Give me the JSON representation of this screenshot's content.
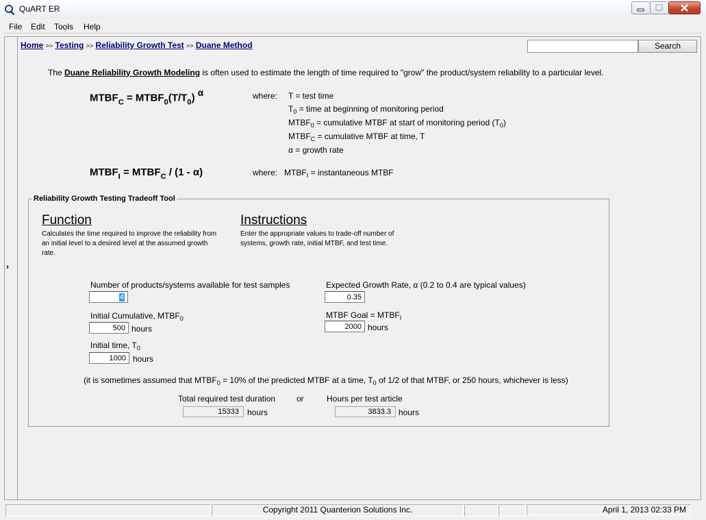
{
  "window": {
    "title": "QuART ER"
  },
  "menu": [
    "File",
    "Edit",
    "Tools",
    "Help"
  ],
  "breadcrumb": [
    {
      "label": "Home"
    },
    {
      "label": "Testing"
    },
    {
      "label": "Reliability Growth Test"
    },
    {
      "label": "Duane Method"
    }
  ],
  "breadcrumb_sep": ">>",
  "search": {
    "value": "",
    "button": "Search"
  },
  "intro": {
    "prefix": "The ",
    "link": "Duane Reliability Growth Modeling",
    "suffix": " is often used to estimate the length of time required to \"grow\" the product/system reliability to a particular level."
  },
  "formula1": {
    "lhs": "MTBF",
    "lhs_sub": "C",
    "mid": " = MTBF",
    "mid_sub": "0",
    "paren_open": "(T/T",
    "paren_sub": "0",
    "paren_close": ")",
    "exp": "α"
  },
  "where1": {
    "label": "where:",
    "lines": [
      {
        "a": "T = test time",
        "sub": "",
        "b": ""
      },
      {
        "a": "T",
        "sub": "0",
        "b": " = time at beginning of monitoring period"
      },
      {
        "a": "MTBF",
        "sub": "0",
        "b": " = cumulative MTBF at start of monitoring period (T",
        "sub2": "0",
        "c": ")"
      },
      {
        "a": "MTBF",
        "sub": "C",
        "b": " = cumulative MTBF at time, T"
      },
      {
        "a": "α",
        "sub": "",
        "b": " = growth rate"
      }
    ]
  },
  "formula2": {
    "lhs": "MTBF",
    "lhs_sub": "I",
    "mid": "  = MTBF",
    "mid_sub": "C",
    "rest": " / (1 - α)"
  },
  "where2": {
    "label": "where:",
    "a": "MTBF",
    "sub": "I",
    "b": " = instantaneous MTBF"
  },
  "tool": {
    "legend": "Reliability Growth Testing Tradeoff Tool",
    "function_heading": "Function",
    "function_text": "Calculates the time required to improve the reliability from an initial level to a desired level at the assumed growth rate.",
    "instructions_heading": "Instructions",
    "instructions_text": "Enter the appropriate values to trade-off number of systems, growth rate, initial MTBF, and test time.",
    "num_systems_label": "Number of products/systems available for test samples",
    "num_systems_value": "4",
    "growth_rate_label": "Expected Growth Rate, α  (0.2 to 0.4 are typical values)",
    "growth_rate_value": "0.35",
    "initial_mtbf_label": "Initial Cumulative, MTBF",
    "initial_mtbf_sub": "0",
    "initial_mtbf_value": "500",
    "goal_label": "MTBF Goal = MTBF",
    "goal_sub": "I",
    "goal_value": "2000",
    "initial_time_label": "Initial time, T",
    "initial_time_sub": "0",
    "initial_time_value": "1000",
    "hours": "hours",
    "note_a": "(it is sometimes assumed that MTBF",
    "note_sub": "0",
    "note_b": " = 10% of the predicted MTBF at a time, T",
    "note_sub2": "0",
    "note_c": " of 1/2 of that MTBF, or 250 hours, whichever is less)",
    "total_label": "Total required test duration",
    "or_label": "or",
    "per_article_label": "Hours per test article",
    "total_value": "15333",
    "per_article_value": "3833.3"
  },
  "status": {
    "copyright": "Copyright 2011 Quanterion Solutions Inc.",
    "datetime": "April 1, 2013  02:33 PM"
  }
}
